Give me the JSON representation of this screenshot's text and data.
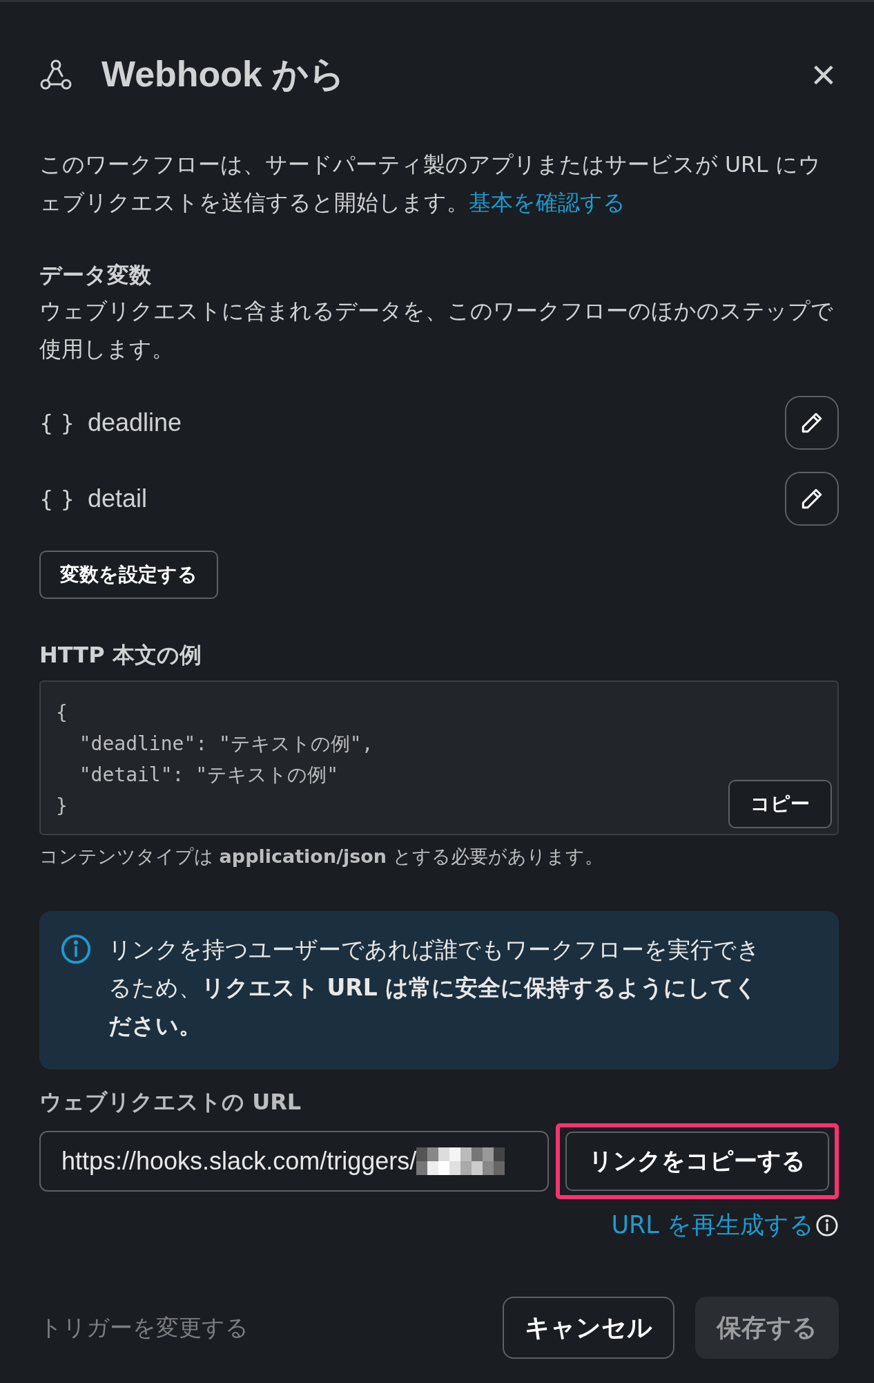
{
  "header": {
    "title": "Webhook から",
    "close": "×"
  },
  "description": {
    "text": "このワークフローは、サードパーティ製のアプリまたはサービスが URL にウェブリクエストを送信すると開始します。",
    "link": "基本を確認する"
  },
  "variables_section": {
    "title": "データ変数",
    "text": "ウェブリクエストに含まれるデータを、このワークフローのほかのステップで使用します。"
  },
  "variables": [
    {
      "icon": "{ }",
      "name": "deadline"
    },
    {
      "icon": "{ }",
      "name": "detail"
    }
  ],
  "set_variables_button": "変数を設定する",
  "http_example": {
    "title": "HTTP 本文の例",
    "lines": [
      "{",
      "  \"deadline\": \"テキストの例\",",
      "  \"detail\": \"テキストの例\"",
      "}"
    ],
    "copy_button": "コピー",
    "note": "コンテンツタイプは **application/json** とする必要があります。"
  },
  "info_box": {
    "text": "リンクを持つユーザーであれば誰でもワークフローを実行できるため、**リクエスト URL は常に安全に保持するようにしてください。**"
  },
  "url_section": {
    "label": "ウェブリクエストの URL",
    "value": "https://hooks.slack.com/triggers/",
    "copy_button": {
      "label": "リンクをコピーする",
      "highlighted": true
    },
    "regenerate_link": "URL を再生成する"
  },
  "footer": {
    "change_trigger": {
      "label": "トリガーを変更する",
      "disabled": true
    },
    "cancel": "キャンセル",
    "save": {
      "label": "保存する",
      "disabled": true
    }
  }
}
